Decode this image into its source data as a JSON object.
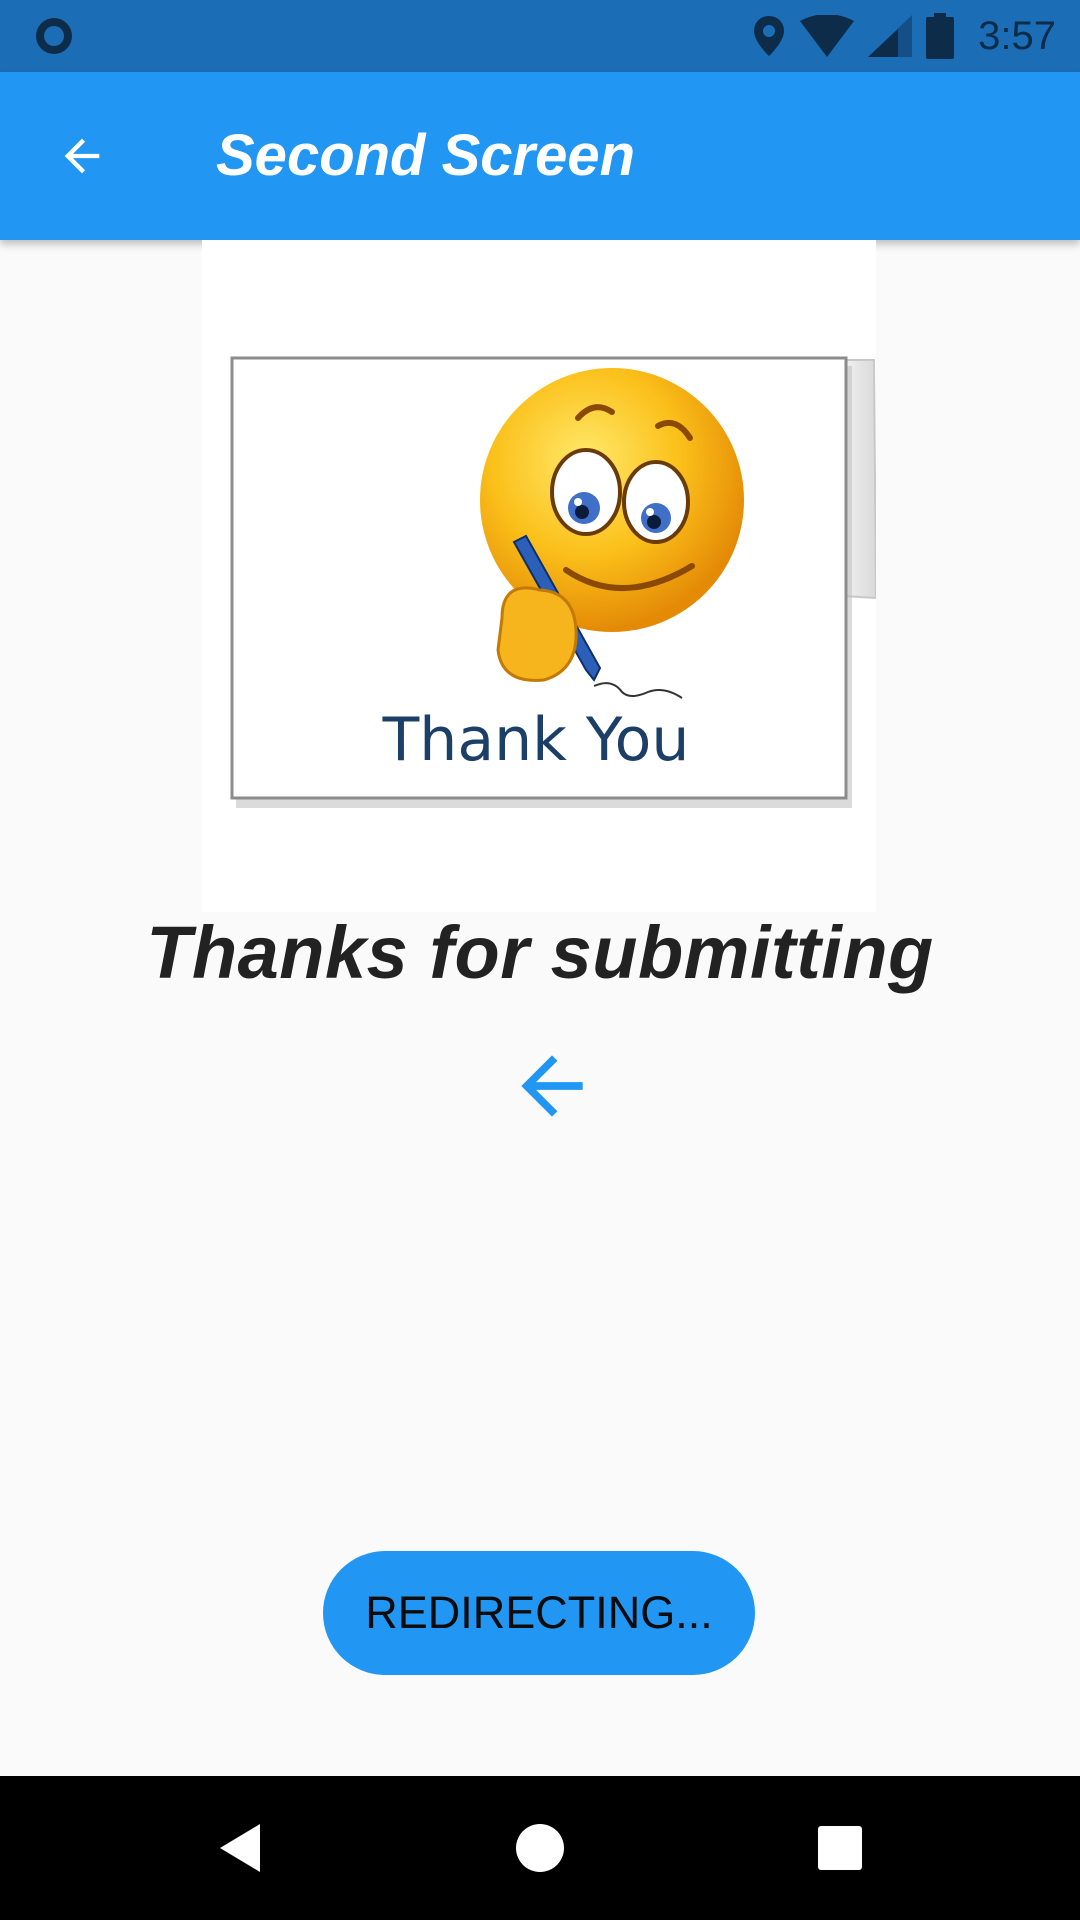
{
  "status_bar": {
    "time": "3:57",
    "icons": [
      "notification-circle-icon",
      "location-icon",
      "wifi-icon",
      "cell-signal-icon",
      "battery-icon"
    ]
  },
  "app_bar": {
    "title": "Second Screen",
    "back_icon": "arrow-back-icon"
  },
  "card_image": {
    "caption": "Thank You",
    "content": "smiley-writing-card"
  },
  "main": {
    "message": "Thanks for submitting",
    "back_icon": "arrow-back-icon"
  },
  "button": {
    "label": "REDIRECTING..."
  },
  "nav_bar": {
    "icons": [
      "back-triangle-icon",
      "home-circle-icon",
      "recents-square-icon"
    ]
  },
  "colors": {
    "status_bar": "#1b6eb6",
    "app_bar": "#2196f3",
    "accent": "#2196f3",
    "background": "#fafafa"
  }
}
